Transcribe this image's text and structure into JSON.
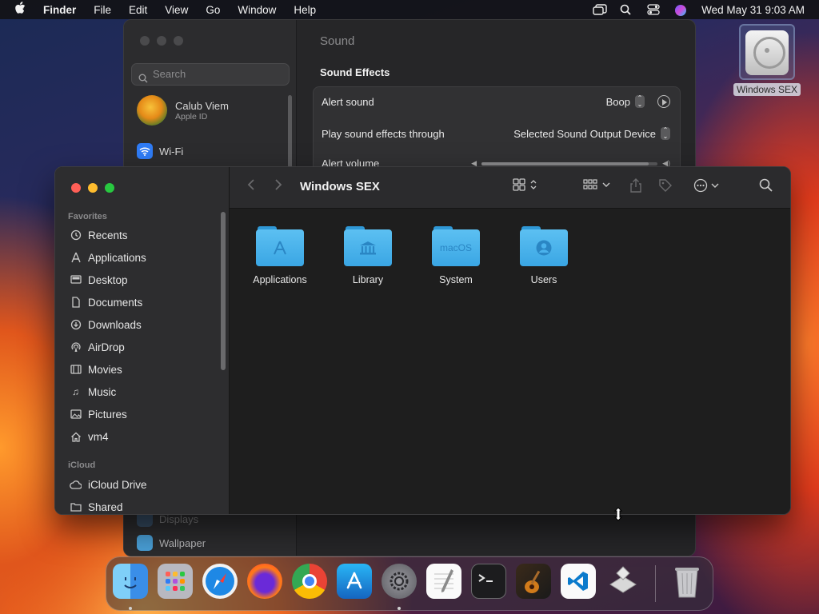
{
  "menubar": {
    "app_name": "Finder",
    "menus": [
      "File",
      "Edit",
      "View",
      "Go",
      "Window",
      "Help"
    ],
    "datetime": "Wed May 31  9:03 AM"
  },
  "settings": {
    "search_placeholder": "Search",
    "user_name": "Calub Viem",
    "user_sub": "Apple ID",
    "items": [
      "Wi-Fi",
      "Displays",
      "Wallpaper"
    ],
    "title": "Sound",
    "section": "Sound Effects",
    "alert_sound_label": "Alert sound",
    "alert_sound_value": "Boop",
    "play_through_label": "Play sound effects through",
    "play_through_value": "Selected Sound Output Device",
    "alert_volume_label": "Alert volume",
    "alert_volume_level": 0.95
  },
  "desktop": {
    "drive_label": "Windows SEX"
  },
  "finder": {
    "title": "Windows SEX",
    "favorites_header": "Favorites",
    "icloud_header": "iCloud",
    "favorites": [
      {
        "label": "Recents",
        "icon": "clock-icon"
      },
      {
        "label": "Applications",
        "icon": "applications-icon"
      },
      {
        "label": "Desktop",
        "icon": "desktop-icon"
      },
      {
        "label": "Documents",
        "icon": "document-icon"
      },
      {
        "label": "Downloads",
        "icon": "download-icon"
      },
      {
        "label": "AirDrop",
        "icon": "airdrop-icon"
      },
      {
        "label": "Movies",
        "icon": "film-icon"
      },
      {
        "label": "Music",
        "icon": "music-icon"
      },
      {
        "label": "Pictures",
        "icon": "photo-icon"
      },
      {
        "label": "vm4",
        "icon": "home-icon"
      }
    ],
    "icloud": [
      {
        "label": "iCloud Drive",
        "icon": "cloud-icon"
      },
      {
        "label": "Shared",
        "icon": "shared-folder-icon"
      }
    ],
    "folders": [
      {
        "name": "Applications",
        "badge": "A"
      },
      {
        "name": "Library",
        "badge": "🏛"
      },
      {
        "name": "System",
        "badge": "macOS"
      },
      {
        "name": "Users",
        "badge": "👤"
      }
    ]
  },
  "dock": {
    "apps": [
      "Finder",
      "Launchpad",
      "Safari",
      "Firefox",
      "Chrome",
      "App Store",
      "System Settings",
      "TextEdit",
      "Terminal",
      "GarageBand",
      "Visual Studio Code",
      "Installer",
      "Trash"
    ]
  },
  "colors": {
    "folder_blue": "#3aa6e4",
    "close": "#ff5f57",
    "minimize": "#febc2e",
    "zoom": "#28c840"
  }
}
